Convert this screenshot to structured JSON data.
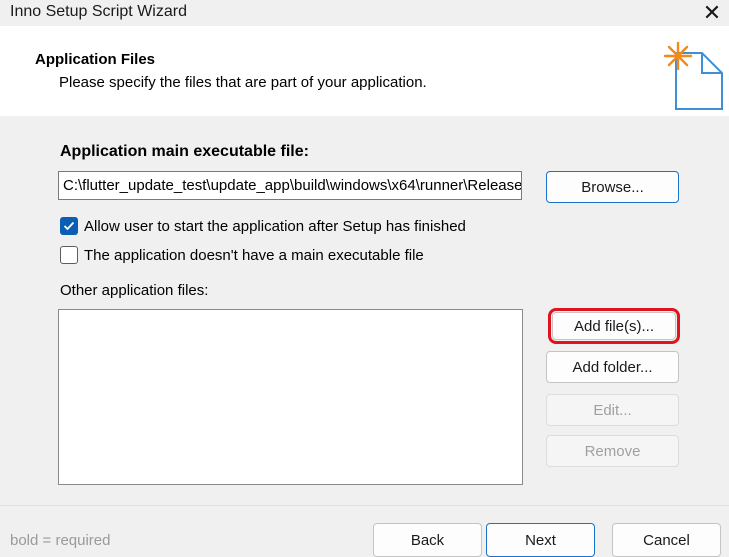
{
  "window": {
    "title": "Inno Setup Script Wizard",
    "close_glyph": "✕"
  },
  "header": {
    "title": "Application Files",
    "subtitle": "Please specify the files that are part of your application.",
    "icon": "wizard-document-star-icon"
  },
  "main_exe": {
    "label": "Application main executable file:",
    "value": "C:\\flutter_update_test\\update_app\\build\\windows\\x64\\runner\\Release\\update_app.exe",
    "browse_label": "Browse..."
  },
  "options": {
    "allow_start": {
      "label": "Allow user to start the application after Setup has finished",
      "checked": true
    },
    "no_main_exe": {
      "label": "The application doesn't have a main executable file",
      "checked": false
    }
  },
  "other_files": {
    "label": "Other application files:",
    "items": [],
    "add_files_label": "Add file(s)...",
    "add_folder_label": "Add folder...",
    "edit_label": "Edit...",
    "remove_label": "Remove"
  },
  "footer": {
    "note": "bold = required",
    "back_label": "Back",
    "next_label": "Next",
    "cancel_label": "Cancel"
  },
  "colors": {
    "accent": "#0a5eb4",
    "highlight_box": "#e0141e"
  }
}
